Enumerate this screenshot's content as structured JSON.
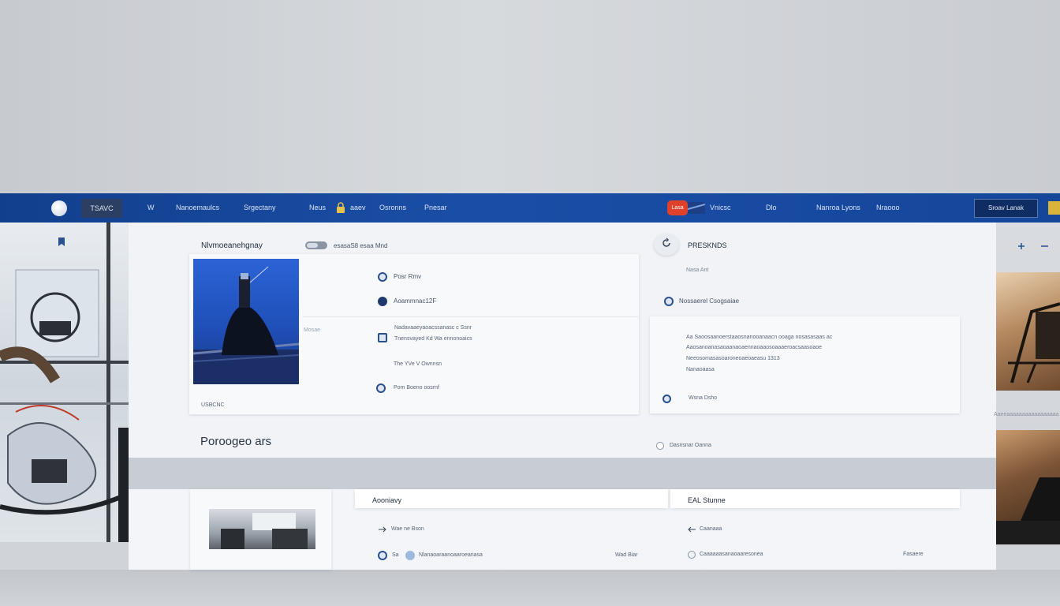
{
  "nav": {
    "home_label": "TSAVC",
    "items": [
      "W",
      "Nanoemaulcs",
      "Srgectany",
      "Neus",
      "aaev",
      "Osronns",
      "Pnesar"
    ],
    "badge": "Lasa",
    "region": "Vnicsc",
    "lang": "Dlo",
    "link_a": "Nanroa Lyons",
    "link_b": "Nraooo",
    "cta_label": "Sroav Lanak"
  },
  "product": {
    "heading": "Nlvmoeanehgnay",
    "toggle_text": "esasaS8 esaa Mnd",
    "caption": "USBCNC",
    "list": [
      {
        "icon": "globe-icon",
        "text": "Posr Rmv"
      },
      {
        "icon": "clock-icon",
        "text": "Aoammnac12F"
      },
      {
        "icon": "document-icon",
        "text": "Nadavaaeyaoacssanasc c Ssnr"
      },
      {
        "icon": "document-icon",
        "text": "Tnensvayed Kd Wa ennonoaics"
      },
      {
        "icon": "none",
        "text": "The YVe V Ownnsn"
      },
      {
        "icon": "camera-icon",
        "text": "Pom Boeno oosrnf"
      }
    ],
    "side_tag": "Mosae"
  },
  "details": {
    "title": "PRESKNDS",
    "subtitle": "Nasa Ant",
    "item": "Nossaerel Csogsaiae",
    "paragraph_lines": [
      "Aa Saoosaanoerstaaosnanooanaacn ooaga nosasasaas ac",
      "Aaosanoanasaoaanaoaennaoaaosoaaaeroacsaasoaoe",
      "Neeosomasasoaroneoaeoaeasu 1313",
      "Nanaoaasa"
    ],
    "footer": "Wsna Dsho"
  },
  "section": {
    "title": "Poroogeo ars",
    "aside": "Dasnsnar Oanna"
  },
  "lower": {
    "left_title": "Aooniavy",
    "left_sub": "Wae ne Bson",
    "left_row": "Nlanaoaraanoaaroeanasa",
    "left_row_prefix": "Sa",
    "left_row_right": "Wad Biar",
    "right_title": "EAL Stunne",
    "right_sub": "Caanaaa",
    "right_row": "Caaaaaasanaoaaresonea",
    "right_row_right": "Fasaere"
  },
  "right_rail_caption": "Aaeeaaaaaaaaaaaaaaaaa",
  "colors": {
    "nav_blue": "#1a4ea6",
    "badge_red": "#e0412a",
    "accent_yellow": "#d9b33a"
  }
}
